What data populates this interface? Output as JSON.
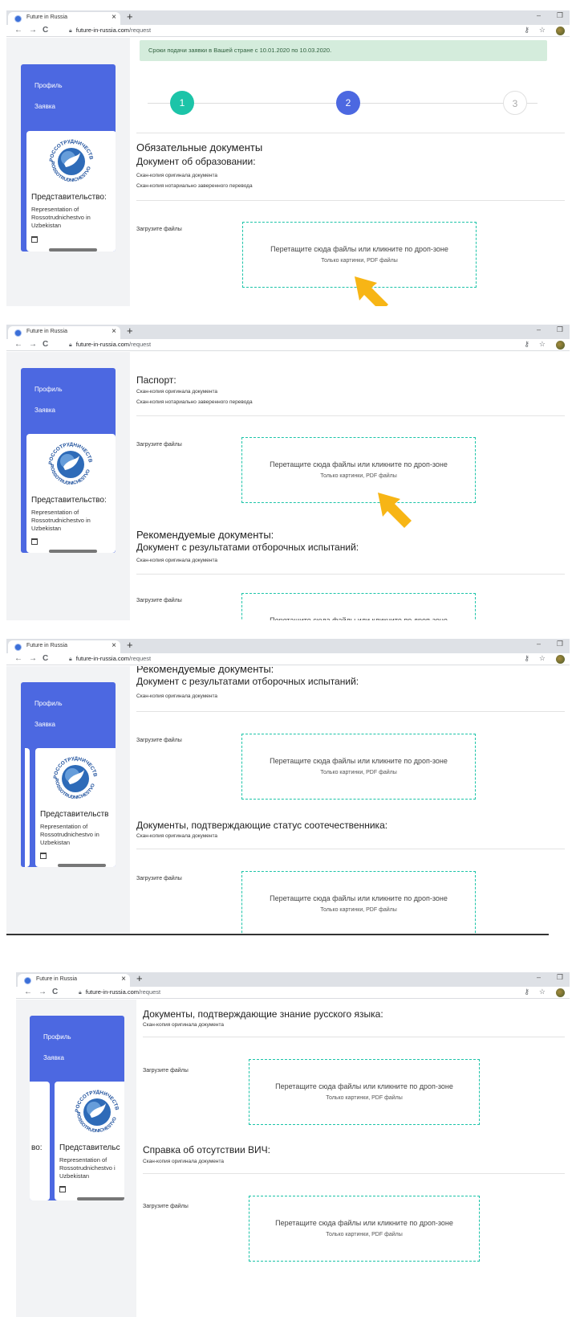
{
  "browser": {
    "tab_title": "Future in Russia",
    "tab_close": "×",
    "new_tab": "+",
    "win_minimize": "–",
    "win_restore": "❐",
    "nav_back": "←",
    "nav_forward": "→",
    "nav_reload": "C",
    "url_host": "future-in-russia.com",
    "url_path": "/request",
    "key_icon": "⚷",
    "star_icon": "☆",
    "colors": {
      "tabbar": "#dee1e6",
      "sidebar": "#4c68e1",
      "accent_green": "#1cc4a8",
      "step_active": "#4c68e1",
      "step_done": "#1cc4a8"
    }
  },
  "sidebar": {
    "items": [
      {
        "label": "Профиль"
      },
      {
        "label": "Заявка"
      }
    ],
    "card": {
      "title": "Представительство:",
      "title_clipped": "Представительств",
      "title_clipped_short": "Представительс",
      "partial_prev_label": "во:",
      "text_line1": "Representation of",
      "text_line2": "Rossotrudnichestvo in",
      "text_line2_short": "Rossotrudnichestvo i",
      "text_line3": "Uzbekistan",
      "logo_top": "РОССОТРУДНИЧЕСТВО",
      "logo_bottom": "ROSSOTRUDNICHESTVO"
    }
  },
  "notice": "Сроки подачи заявки в Вашей стране с 10.01.2020 по 10.03.2020.",
  "steps": [
    {
      "label": "1"
    },
    {
      "label": "2"
    },
    {
      "label": "3"
    }
  ],
  "sections": {
    "required": "Обязательные документы",
    "recommended": "Рекомендуемые документы:"
  },
  "docs": {
    "education": {
      "title": "Документ об образовании:",
      "req1": "Скан-копия оригинала документа",
      "req2": "Скан-копия нотариально заверенного перевода"
    },
    "passport": {
      "title": "Паспорт:",
      "req1": "Скан-копия оригинала документа",
      "req2": "Скан-копия нотариально заверенного перевода"
    },
    "selection": {
      "title": "Документ с результатами отборочных испытаний:",
      "req1": "Скан-копия оригинала документа"
    },
    "compatriot": {
      "title": "Документы, подтверждающие статус соотечественника:",
      "req1": "Скан-копия оригинала документа"
    },
    "russian": {
      "title": "Документы, подтверждающие знание русского языка:",
      "req1": "Скан-копия оригинала документа"
    },
    "hiv": {
      "title": "Справка об отсутствии ВИЧ:",
      "req1": "Скан-копия оригинала документа"
    }
  },
  "upload": {
    "label": "Загрузите файлы",
    "drop_text": "Перетащите сюда файлы или кликните по дроп-зоне",
    "drop_hint": "Только картинки, PDF файлы"
  }
}
